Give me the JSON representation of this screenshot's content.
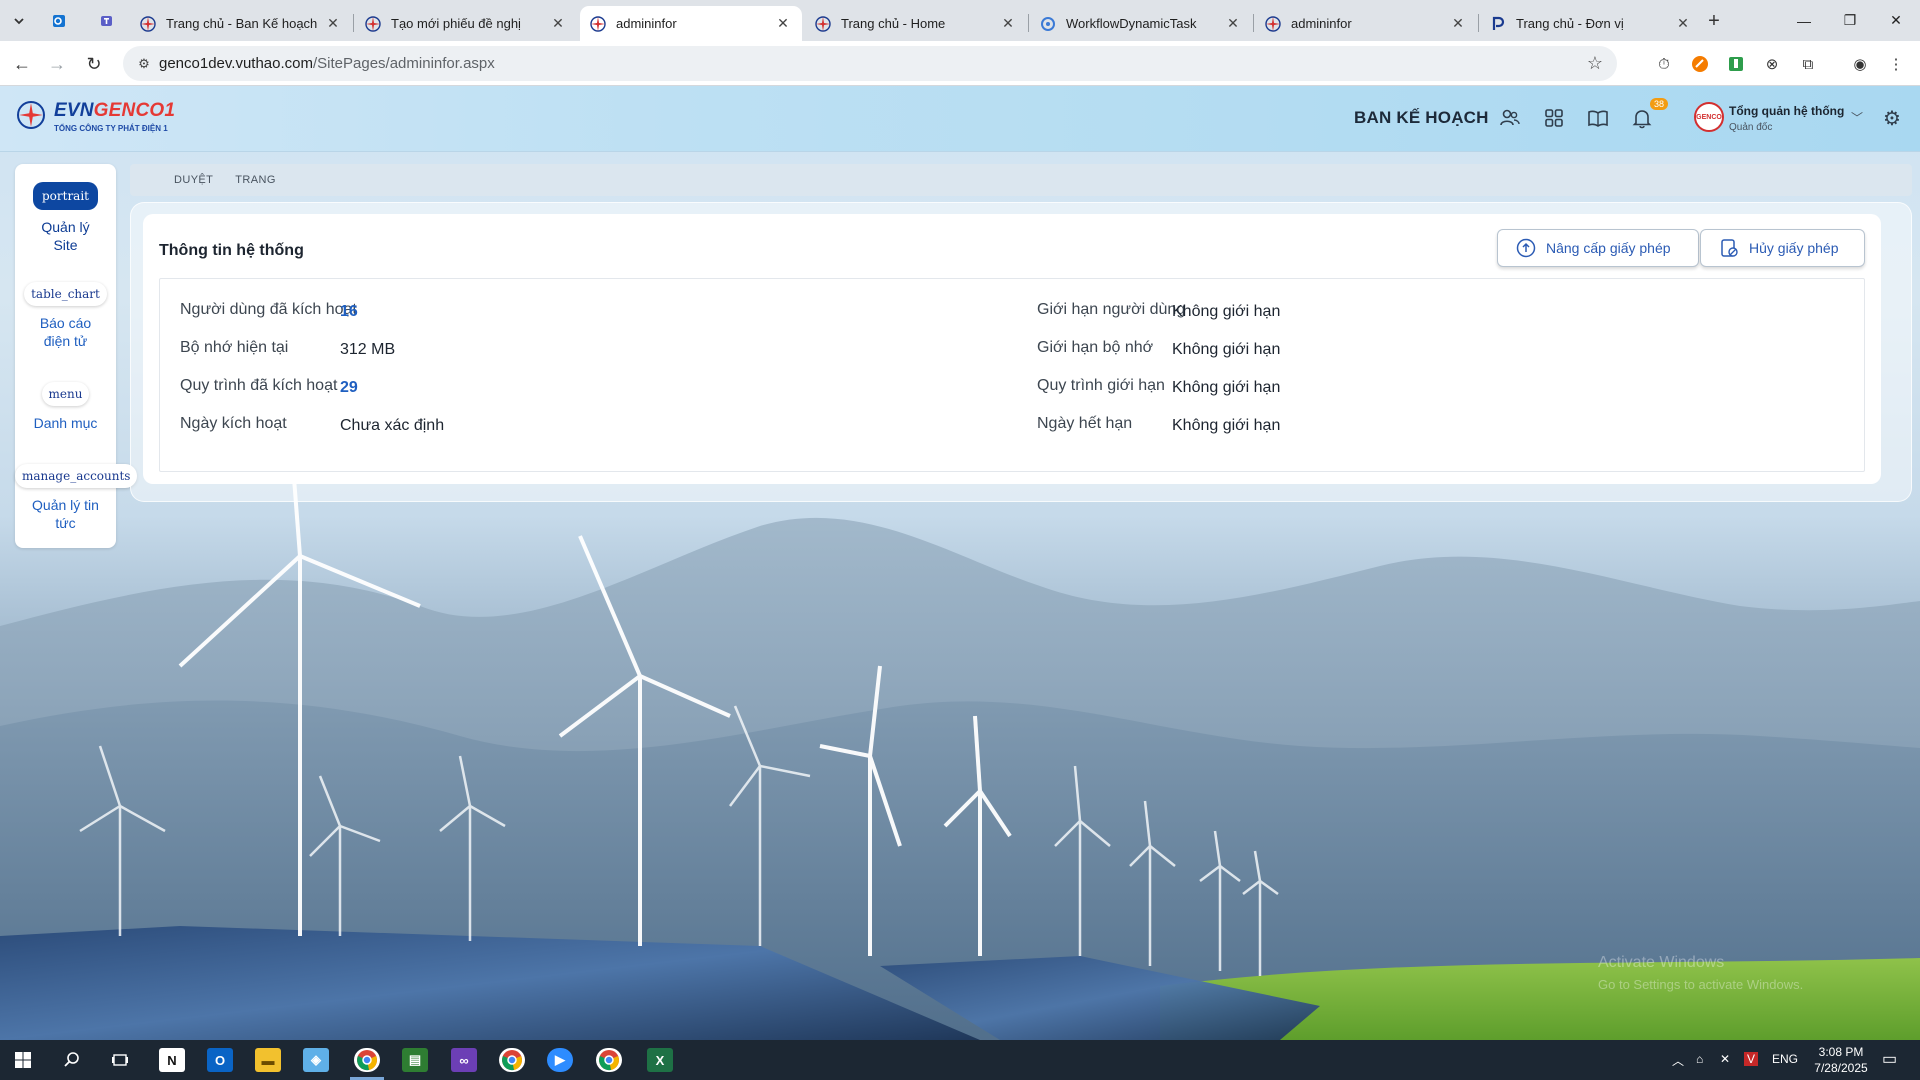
{
  "browser": {
    "tabs": [
      {
        "label": "Trang chủ - Ban Kế hoạch",
        "favicon": "evn-icon"
      },
      {
        "label": "Tạo mới phiếu đề nghị",
        "favicon": "evn-icon"
      },
      {
        "label": "admininfor",
        "favicon": "evn-icon",
        "active": true
      },
      {
        "label": "Trang chủ - Home",
        "favicon": "evn-icon"
      },
      {
        "label": "WorkflowDynamicTask",
        "favicon": "workflow-icon"
      },
      {
        "label": "admininfor",
        "favicon": "evn-icon"
      },
      {
        "label": "Trang chủ - Đơn vị",
        "favicon": "p-icon"
      }
    ],
    "url_host": "genco1dev.vuthao.com",
    "url_path": "/SitePages/admininfor.aspx"
  },
  "header": {
    "logo_name_a": "EVN",
    "logo_name_b": "GENCO1",
    "logo_sub": "TỔNG CÔNG TY PHÁT ĐIỆN 1",
    "department": "BAN KẾ HOẠCH",
    "notification_count": "38",
    "avatar_text": "GENCO",
    "user_name": "Tổng quản hệ thống",
    "user_role": "Quản đốc"
  },
  "sidebar": {
    "items": [
      {
        "icon": "portrait",
        "label_1": "Quản lý",
        "label_2": "Site",
        "active": true
      },
      {
        "icon": "table_chart",
        "label_1": "Báo cáo",
        "label_2": "điện tử"
      },
      {
        "icon": "menu",
        "label_1": "Danh mục",
        "label_2": ""
      },
      {
        "icon": "manage_accounts",
        "label_1": "Quản lý tin",
        "label_2": "tức"
      }
    ]
  },
  "breadcrumb": [
    "DUYỆT",
    "TRANG"
  ],
  "card": {
    "title": "Thông tin hệ thống",
    "upgrade_label": "Nâng cấp giấy phép",
    "cancel_label": "Hủy giấy phép"
  },
  "info": {
    "left": [
      {
        "label": "Người dùng đã kích hoạt",
        "value": "16",
        "numeric": true
      },
      {
        "label": "Bộ nhớ hiện tại",
        "value": "312 MB"
      },
      {
        "label": "Quy trình đã kích hoạt",
        "value": "29",
        "numeric": true
      },
      {
        "label": "Ngày kích hoạt",
        "value": "Chưa xác định"
      }
    ],
    "right": [
      {
        "label": "Giới hạn người dùng",
        "value": "Không giới hạn"
      },
      {
        "label": "Giới hạn bộ nhớ",
        "value": "Không giới hạn"
      },
      {
        "label": "Quy trình giới hạn",
        "value": "Không giới hạn"
      },
      {
        "label": "Ngày hết hạn",
        "value": "Không giới hạn"
      }
    ]
  },
  "watermark": {
    "line1": "Activate Windows",
    "line2": "Go to Settings to activate Windows."
  },
  "taskbar": {
    "language": "ENG",
    "time": "3:08 PM",
    "date": "7/28/2025"
  },
  "colors": {
    "brand": "#0d47a1",
    "accent": "#e53935",
    "link": "#1f5fc0"
  }
}
